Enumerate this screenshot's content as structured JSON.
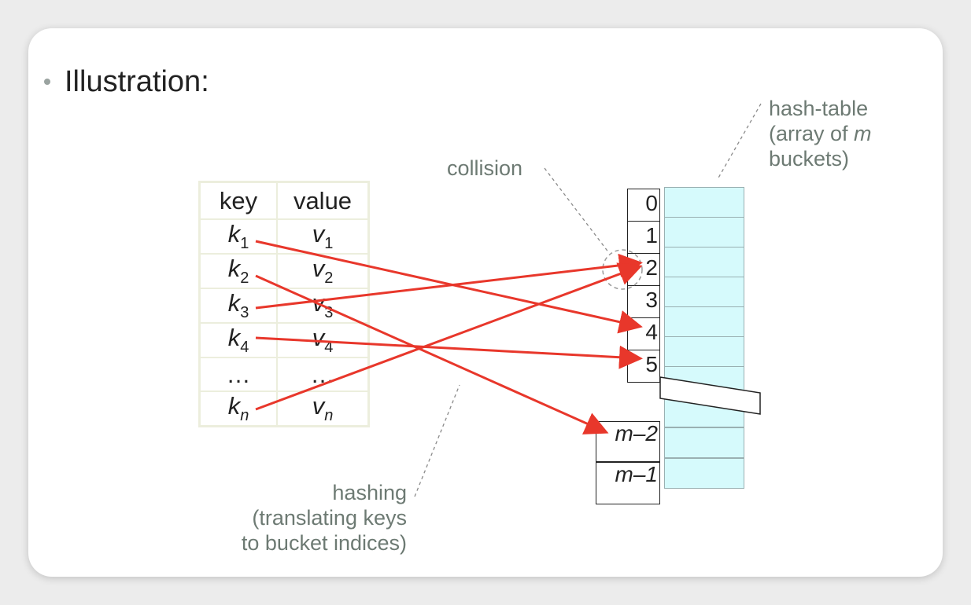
{
  "slide": {
    "heading": "Illustration:"
  },
  "annotations": {
    "collision": "collision",
    "hash_table_line1": "hash-table",
    "hash_table_line2_pre": "(array of ",
    "hash_table_m": "m",
    "hash_table_line3": "buckets)",
    "hashing_line1": "hashing",
    "hashing_line2": "(translating keys",
    "hashing_line3": "to bucket indices)"
  },
  "kv_table": {
    "header_key": "key",
    "header_value": "value",
    "rows": [
      {
        "k": "k",
        "k_sub": "1",
        "v": "v",
        "v_sub": "1"
      },
      {
        "k": "k",
        "k_sub": "2",
        "v": "v",
        "v_sub": "2"
      },
      {
        "k": "k",
        "k_sub": "3",
        "v": "v",
        "v_sub": "3"
      },
      {
        "k": "k",
        "k_sub": "4",
        "v": "v",
        "v_sub": "4"
      },
      {
        "k": "…",
        "k_sub": "",
        "v": "…",
        "v_sub": ""
      },
      {
        "k": "k",
        "k_sub": "n",
        "v": "v",
        "v_sub": "n"
      }
    ]
  },
  "indices": [
    "0",
    "1",
    "2",
    "3",
    "4",
    "5",
    "m–2",
    "m–1"
  ],
  "colors": {
    "arrow": "#e8372b",
    "bucket_fill": "#d6fafc",
    "note_text": "#6d7a73",
    "table_border": "#eceedd"
  }
}
